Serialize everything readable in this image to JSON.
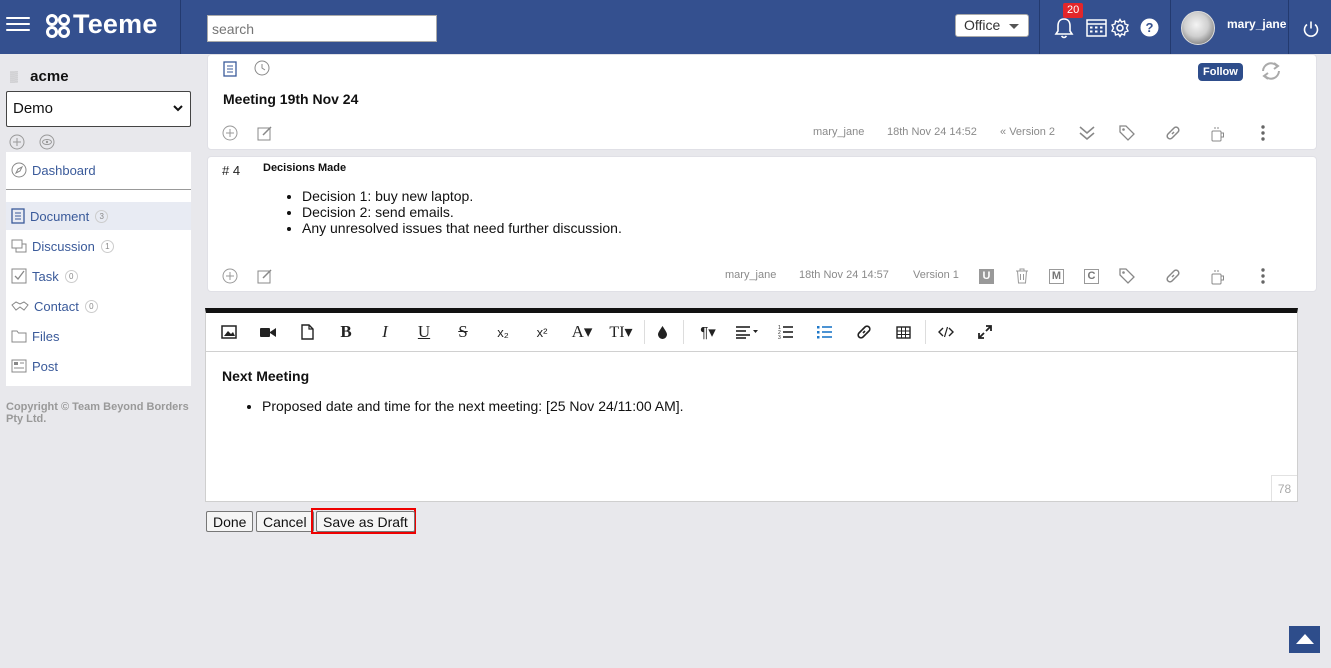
{
  "app": {
    "name": "Teeme"
  },
  "header": {
    "search_placeholder": "search",
    "space_select": "Office",
    "notification_count": "20",
    "username": "mary_jane"
  },
  "sidebar": {
    "org_name": "acme",
    "space": "Demo",
    "items": [
      {
        "label": "Dashboard",
        "count": ""
      },
      {
        "label": "Document",
        "count": "3"
      },
      {
        "label": "Discussion",
        "count": "1"
      },
      {
        "label": "Task",
        "count": "0"
      },
      {
        "label": "Contact",
        "count": "0"
      },
      {
        "label": "Files",
        "count": ""
      },
      {
        "label": "Post",
        "count": ""
      }
    ],
    "copyright": "Copyright © Team Beyond Borders Pty Ltd."
  },
  "document": {
    "follow_label": "Follow",
    "title": "Meeting 19th Nov 24",
    "author": "mary_jane",
    "timestamp": "18th Nov 24 14:52",
    "version": "Version 2"
  },
  "section": {
    "number": "# 4",
    "heading": "Decisions Made",
    "items": [
      "Decision 1: buy new laptop.",
      "Decision 2: send emails.",
      "Any unresolved issues that need further discussion."
    ],
    "author": "mary_jane",
    "timestamp": "18th Nov 24 14:57",
    "version": "Version 1",
    "letter_u": "U",
    "letter_m": "M",
    "letter_c": "C"
  },
  "editor": {
    "heading": "Next Meeting",
    "bullet": "Proposed date and time for the next meeting: [25 Nov 24/11:00 AM].",
    "char_count": "78",
    "toolbar": {
      "bold": "B",
      "italic": "I",
      "underline": "U",
      "strike": "S",
      "subscript": "x₂",
      "superscript": "x²",
      "font_color": "A▾",
      "font_size": "TI▾",
      "paragraph": "¶▾"
    }
  },
  "actions": {
    "done": "Done",
    "cancel": "Cancel",
    "save_draft": "Save as Draft"
  }
}
